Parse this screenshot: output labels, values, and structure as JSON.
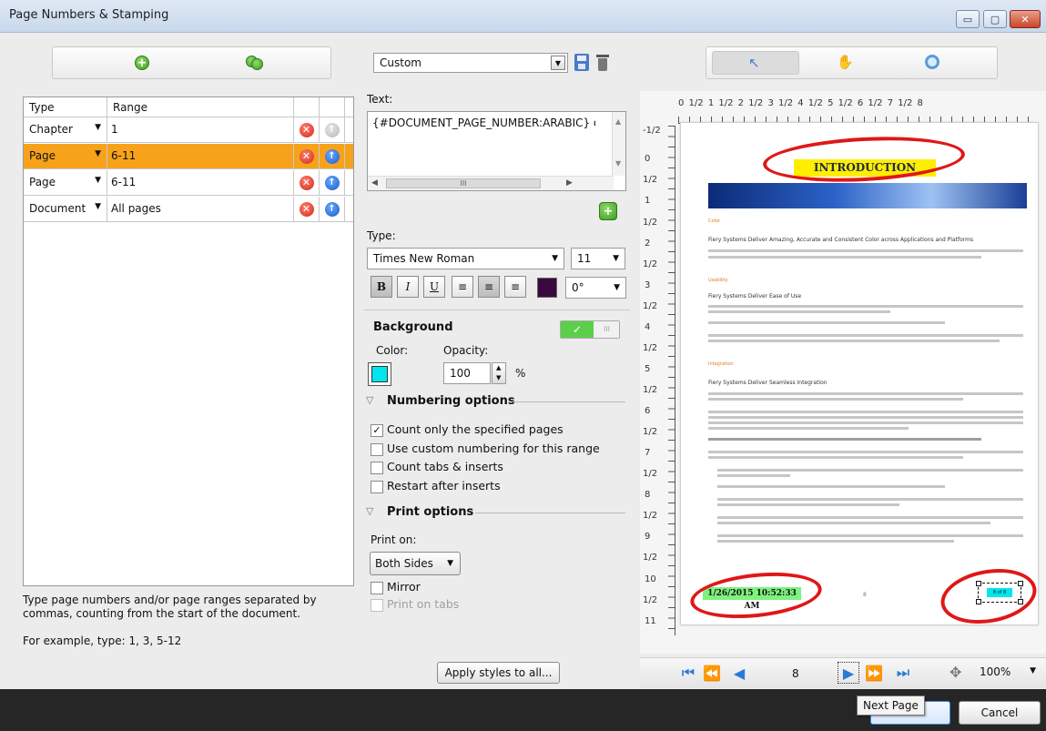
{
  "window": {
    "title": "Page Numbers & Stamping",
    "minimize": "▭",
    "maximize": "▢",
    "close": "✕"
  },
  "left_toolbar": {
    "add_icon": "plus-circle-icon",
    "duplicate_icon": "duplicate-circles-icon"
  },
  "ranges_table": {
    "columns": [
      "Type",
      "Range"
    ],
    "rows": [
      {
        "type": "Chapter",
        "range": "1",
        "selected": false
      },
      {
        "type": "Page",
        "range": "6-11",
        "selected": true
      },
      {
        "type": "Page",
        "range": "6-11",
        "selected": false
      },
      {
        "type": "Document",
        "range": "All pages",
        "selected": false
      }
    ]
  },
  "left_help": {
    "instructions": "Type page numbers and/or page ranges separated by commas, counting from the start of the document.",
    "example": "For example, type: 1, 3, 5-12"
  },
  "style": {
    "preset": "Custom",
    "text_label": "Text:",
    "text_value": "{#DOCUMENT_PAGE_NUMBER:ARABIC} of",
    "scroll_thumb": "III",
    "type_label": "Type:",
    "font": "Times New Roman",
    "size": "11",
    "bold": "B",
    "italic": "I",
    "underline": "U",
    "rotation": "0°",
    "text_color": "#3a0a3e"
  },
  "background": {
    "title": "Background",
    "toggle_on": "✓",
    "toggle_off": "III",
    "color_label": "Color:",
    "opacity_label": "Opacity:",
    "opacity_value": "100",
    "opacity_unit": "%",
    "color": "#00e5ee"
  },
  "numbering": {
    "title": "Numbering options",
    "options": [
      {
        "label": "Count only the specified pages",
        "checked": true
      },
      {
        "label": "Use custom numbering for this range",
        "checked": false
      },
      {
        "label": "Count tabs & inserts",
        "checked": false
      },
      {
        "label": "Restart after inserts",
        "checked": false
      }
    ]
  },
  "print": {
    "title": "Print options",
    "print_on_label": "Print on:",
    "print_on_value": "Both Sides",
    "mirror_label": "Mirror",
    "tabs_label": "Print on tabs"
  },
  "apply_button": "Apply styles to all...",
  "ruler": {
    "top": "0   1/2  1   1/2  2   1/2  3   1/2  4   1/2  5   1/2  6   1/2  7   1/2  8",
    "left": [
      "-1/2",
      "0",
      "1/2",
      "1",
      "1/2",
      "2",
      "1/2",
      "3",
      "1/2",
      "4",
      "1/2",
      "5",
      "1/2",
      "6",
      "1/2",
      "7",
      "1/2",
      "8",
      "1/2",
      "9",
      "1/2",
      "10",
      "1/2",
      "11"
    ]
  },
  "preview": {
    "banner": "INTRODUCTION",
    "sections": [
      "Color",
      "Usability",
      "Integration"
    ],
    "headings": [
      "Fiery Systems Deliver Amazing, Accurate and Consistent Color across Applications and Platforms",
      "Fiery Systems Deliver Ease of Use",
      "Fiery Systems Deliver Seamless Integration"
    ],
    "timestamp": "1/26/2015 10:52:33 AM",
    "page_stamp": "8",
    "page_number_box": "8 of 8"
  },
  "navigation": {
    "page": "8",
    "zoom": "100%",
    "tooltip": "Next Page"
  },
  "footer": {
    "cancel": "Cancel"
  },
  "colors": {
    "selected_row": "#f7a21b",
    "highlight_banner": "#ffee00",
    "ring": "#e01717",
    "timestamp_bg": "#7ef27e"
  }
}
